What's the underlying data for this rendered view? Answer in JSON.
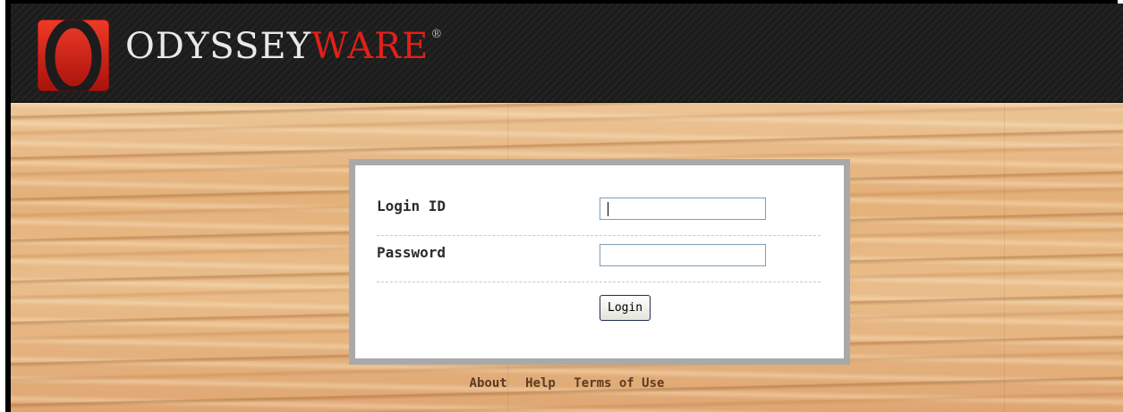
{
  "brand": {
    "name_main": "ODYSSEY",
    "name_accent": "WARE",
    "registered_mark": "®",
    "accent_color": "#e32018",
    "logo_icon": "odysseyware-o-logo"
  },
  "form": {
    "login_id_label": "Login ID",
    "login_id_value": "",
    "password_label": "Password",
    "password_value": "",
    "login_button": "Login"
  },
  "footer": {
    "links": [
      "About",
      "Help",
      "Terms of Use"
    ]
  }
}
